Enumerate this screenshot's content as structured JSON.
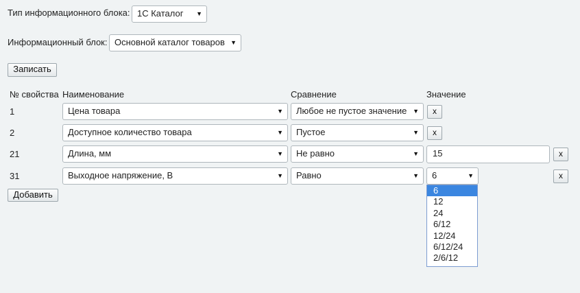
{
  "header": {
    "block_type_label": "Тип информационного блока:",
    "block_type_value": "1С Каталог",
    "block_label": "Информационный блок:",
    "block_value": "Основной каталог товаров",
    "save_button": "Записать"
  },
  "table": {
    "headers": {
      "prop_num": "№ свойства",
      "name": "Наименование",
      "compare": "Сравнение",
      "value": "Значение"
    },
    "rows": [
      {
        "num": "1",
        "name": "Цена товара",
        "compare": "Любое не пустое значение",
        "value_type": "none"
      },
      {
        "num": "2",
        "name": "Доступное количество товара",
        "compare": "Пустое",
        "value_type": "none"
      },
      {
        "num": "21",
        "name": "Длина, мм",
        "compare": "Не равно",
        "value_type": "input",
        "value": "15"
      },
      {
        "num": "31",
        "name": "Выходное напряжение, В",
        "compare": "Равно",
        "value_type": "select",
        "value": "6"
      }
    ],
    "remove_label": "x",
    "add_button": "Добавить"
  },
  "dropdown": {
    "selected": "6",
    "options": [
      "6",
      "12",
      "24",
      "6/12",
      "12/24",
      "6/12/24",
      "2/6/12"
    ]
  },
  "icons": {
    "select_arrow": "dropdown-arrow-icon",
    "remove": "remove-icon"
  },
  "colors": {
    "background": "#f0f3f4",
    "highlight": "#3b86e0"
  }
}
